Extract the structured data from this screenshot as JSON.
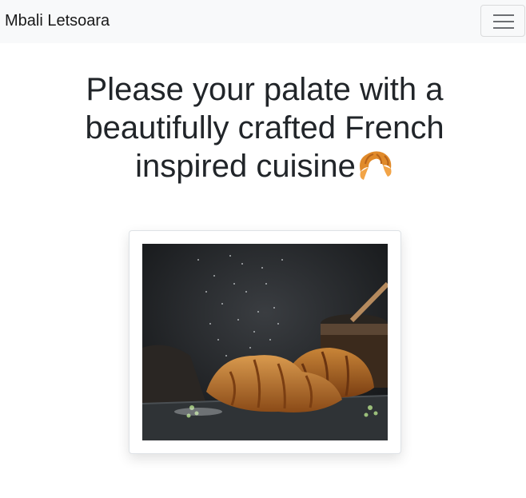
{
  "navbar": {
    "brand": "Mbali Letsoara",
    "toggler_icon": "hamburger-menu-icon"
  },
  "hero": {
    "title": "Please your palate with a beautifully crafted French inspired cuisine",
    "emoji_icon": "croissant-icon"
  },
  "card": {
    "image_subject": "croissant-photo"
  },
  "colors": {
    "navbar_bg": "#f8f9fa",
    "text": "#212529",
    "croissant": "#e08a2a"
  }
}
